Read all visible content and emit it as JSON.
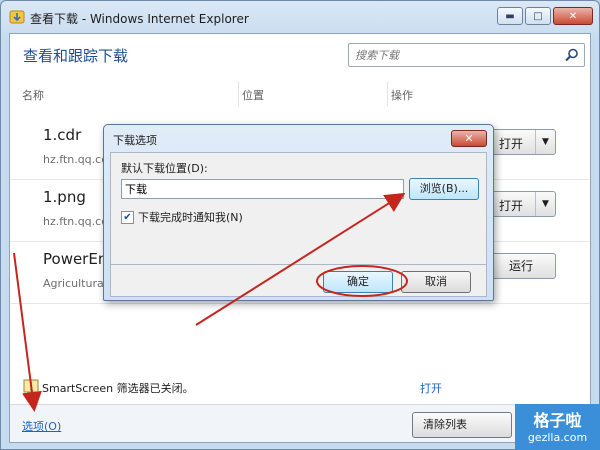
{
  "window": {
    "title": "查看下载 - Windows Internet Explorer"
  },
  "header": {
    "title": "查看和跟踪下载"
  },
  "search": {
    "placeholder": "搜索下载"
  },
  "columns": {
    "name": "名称",
    "location": "位置",
    "action": "操作"
  },
  "downloads": [
    {
      "name": "1.cdr",
      "source": "hz.ftn.qq.cc",
      "action": "打开"
    },
    {
      "name": "1.png",
      "source": "hz.ftn.qq.cc",
      "action": "打开"
    },
    {
      "name": "PowerEn",
      "source": "Agricultural",
      "action": "运行"
    }
  ],
  "smartscreen": {
    "message": "SmartScreen 筛选器已关闭。",
    "link": "打开"
  },
  "footer": {
    "options_label": "选项(O)",
    "clear_label": "清除列表"
  },
  "dialog": {
    "title": "下载选项",
    "location_label": "默认下载位置(D):",
    "location_value": "下载",
    "browse_label": "浏览(B)...",
    "notify_label": "下载完成时通知我(N)",
    "notify_checked": true,
    "ok_label": "确定",
    "cancel_label": "取消"
  },
  "brand": {
    "cn": "格子啦",
    "en": "gezlla.com"
  },
  "colors": {
    "accent": "#1e4e9a",
    "link": "#1b64c2",
    "annotation": "#c4261e"
  }
}
